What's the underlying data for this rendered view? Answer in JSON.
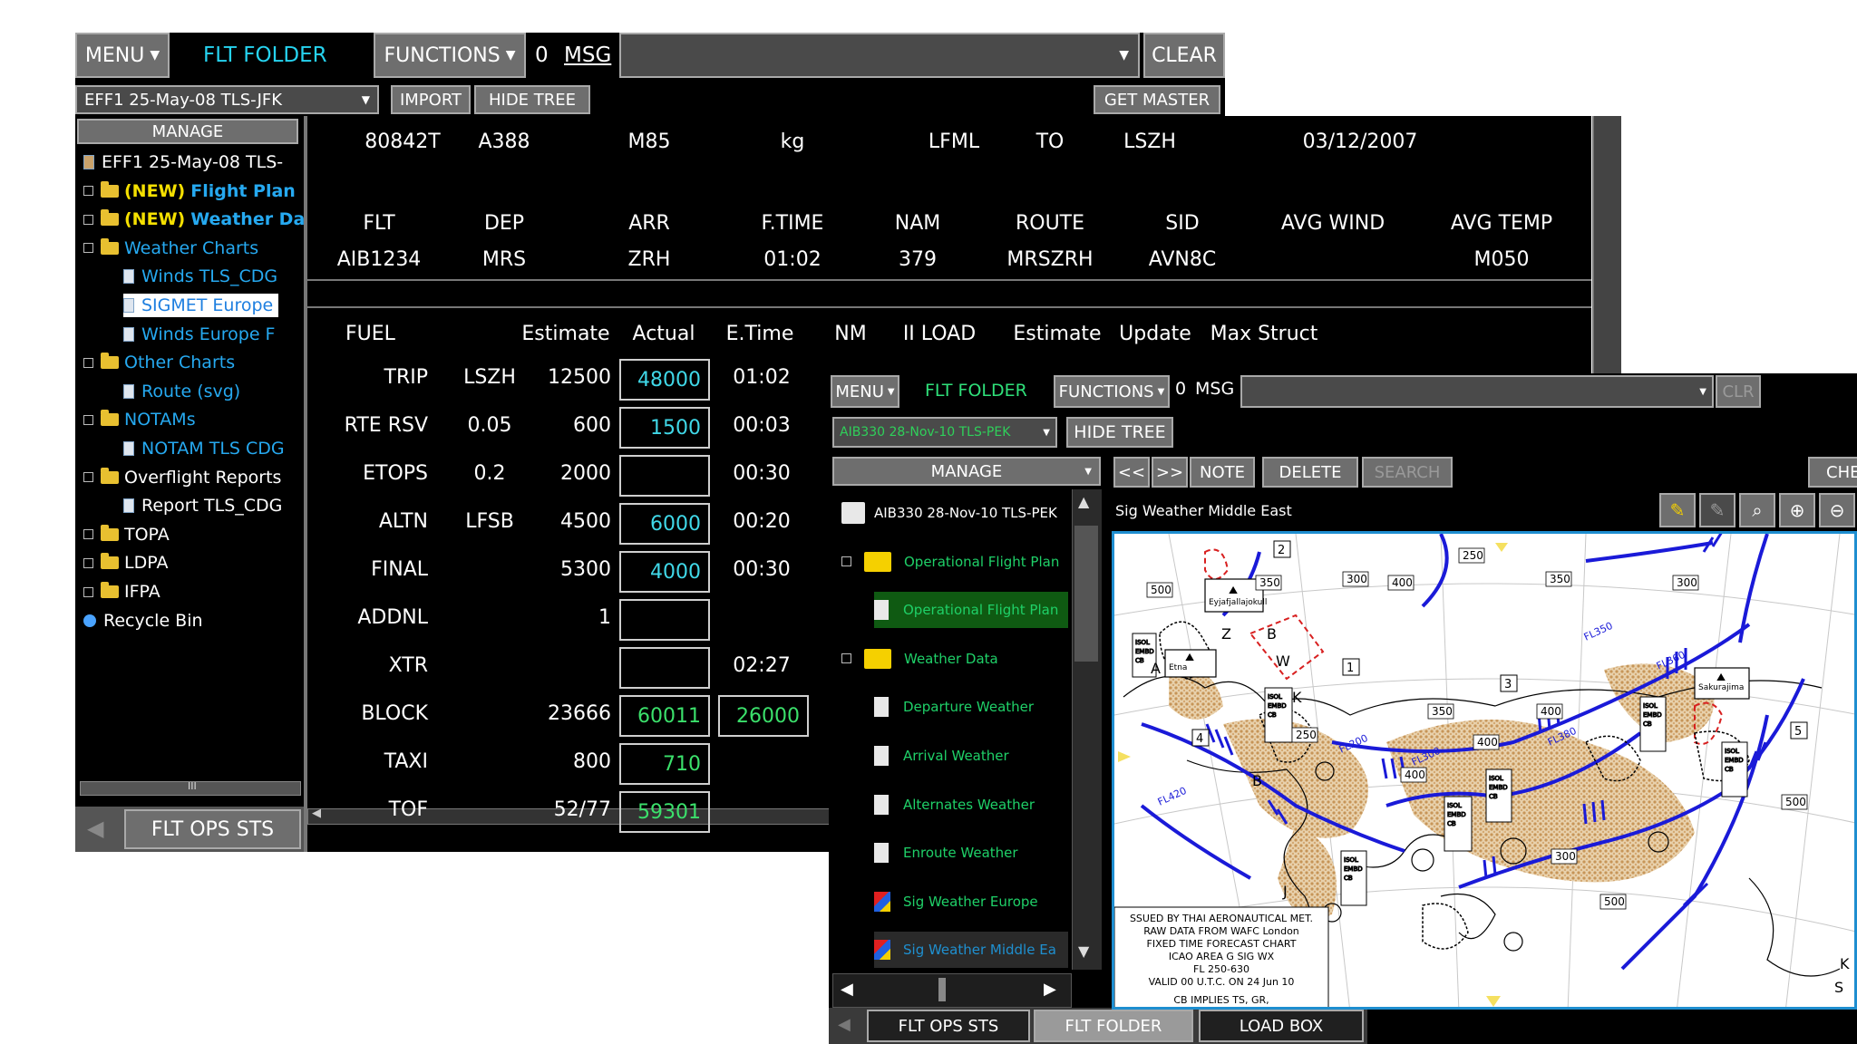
{
  "back_window": {
    "menu": "MENU",
    "app_title": "FLT FOLDER",
    "functions": "FUNCTIONS",
    "msg_count": "0",
    "msg_label": "MSG",
    "clear": "CLEAR",
    "flight_select": "EFF1 25-May-08 TLS-JFK",
    "import": "IMPORT",
    "hide_tree": "HIDE TREE",
    "get_master": "GET MASTER",
    "manage": "MANAGE",
    "tree": [
      {
        "label": "EFF1 25-May-08 TLS-",
        "kind": "root"
      },
      {
        "label": "(NEW) Flight Plan",
        "new_prefix": "(NEW)",
        "rest": "Flight Plan",
        "kind": "new"
      },
      {
        "label": "(NEW) Weather Da",
        "new_prefix": "(NEW)",
        "rest": "Weather Da",
        "kind": "new"
      },
      {
        "label": "Weather Charts",
        "kind": "folder-c"
      },
      {
        "label": "Winds TLS_CDG",
        "kind": "doc-c"
      },
      {
        "label": "SIGMET Europe",
        "kind": "doc-sel"
      },
      {
        "label": "Winds Europe F",
        "kind": "doc-c"
      },
      {
        "label": "Other Charts",
        "kind": "folder-c"
      },
      {
        "label": "Route (svg)",
        "kind": "doc-c"
      },
      {
        "label": "NOTAMs",
        "kind": "folder-c"
      },
      {
        "label": "NOTAM TLS CDG",
        "kind": "doc-c"
      },
      {
        "label": "Overflight Reports",
        "kind": "folder"
      },
      {
        "label": "Report TLS_CDG",
        "kind": "doc"
      },
      {
        "label": "TOPA",
        "kind": "folder"
      },
      {
        "label": "LDPA",
        "kind": "folder"
      },
      {
        "label": "IFPA",
        "kind": "folder"
      },
      {
        "label": "Recycle Bin",
        "kind": "bin"
      }
    ],
    "scroll_mark": "III",
    "bottom_tab": "FLT OPS STS",
    "header_row": [
      "80842T",
      "A388",
      "M85",
      "kg",
      "LFML",
      "TO",
      "LSZH",
      "03/12/2007"
    ],
    "flight_headers": [
      "FLT",
      "DEP",
      "ARR",
      "F.TIME",
      "NAM",
      "ROUTE",
      "SID",
      "AVG WIND",
      "AVG TEMP"
    ],
    "flight_values": [
      "AIB1234",
      "MRS",
      "ZRH",
      "01:02",
      "379",
      "MRSZRH",
      "AVN8C",
      "",
      "M050"
    ],
    "fuel_headers": [
      "FUEL",
      "Estimate",
      "Actual",
      "E.Time",
      "NM",
      "II LOAD",
      "Estimate",
      "Update",
      "Max Struct"
    ],
    "fuel_rows": [
      {
        "name": "TRIP",
        "ref": "LSZH",
        "estimate": "12500",
        "actual": "48000",
        "etime": "01:02"
      },
      {
        "name": "RTE RSV",
        "ref": "0.05",
        "estimate": "600",
        "actual": "1500",
        "etime": "00:03"
      },
      {
        "name": "ETOPS",
        "ref": "0.2",
        "estimate": "2000",
        "actual": "",
        "etime": "00:30"
      },
      {
        "name": "ALTN",
        "ref": "LFSB",
        "estimate": "4500",
        "actual": "6000",
        "etime": "00:20"
      },
      {
        "name": "FINAL",
        "ref": "",
        "estimate": "5300",
        "actual": "4000",
        "etime": "00:30"
      },
      {
        "name": "ADDNL",
        "ref": "",
        "estimate": "1",
        "actual": "",
        "etime": ""
      },
      {
        "name": "XTR",
        "ref": "",
        "estimate": "",
        "actual": "",
        "etime": "02:27"
      },
      {
        "name": "BLOCK",
        "ref": "",
        "estimate": "23666",
        "actual": "60011",
        "etime": "26000"
      },
      {
        "name": "TAXI",
        "ref": "",
        "estimate": "800",
        "actual": "710",
        "etime": ""
      },
      {
        "name": "TOF",
        "ref": "",
        "estimate": "52/77",
        "actual": "59301",
        "etime": ""
      }
    ]
  },
  "front_window": {
    "menu": "MENU",
    "app_title": "FLT FOLDER",
    "functions": "FUNCTIONS",
    "msg_count": "0",
    "msg_label": "MSG",
    "clear": "CLR",
    "flight_select": "AIB330 28-Nov-10 TLS-PEK",
    "hide_tree": "HIDE TREE",
    "manage": "MANAGE",
    "nav_prev": "<<",
    "nav_next": ">>",
    "note": "NOTE",
    "delete": "DELETE",
    "search": "SEARCH",
    "che": "CHE",
    "chart_title": "Sig Weather Middle East",
    "tree": [
      {
        "label": "AIB330 28-Nov-10 TLS-PEK",
        "kind": "root"
      },
      {
        "label": "Operational Flight Plan",
        "kind": "folder"
      },
      {
        "label": "Operational Flight Plan",
        "kind": "doc-sel"
      },
      {
        "label": "Weather Data",
        "kind": "folder"
      },
      {
        "label": "Departure Weather",
        "kind": "doc"
      },
      {
        "label": "Arrival Weather",
        "kind": "doc"
      },
      {
        "label": "Alternates Weather",
        "kind": "doc"
      },
      {
        "label": "Enroute Weather",
        "kind": "doc"
      },
      {
        "label": "Sig Weather Europe",
        "kind": "img"
      },
      {
        "label": "Sig Weather Middle Ea",
        "kind": "img-sel"
      }
    ],
    "tabs": [
      "FLT OPS STS",
      "FLT FOLDER",
      "LOAD BOX"
    ],
    "map": {
      "legend_lines": [
        "SSUED BY THAI AERONAUTICAL MET.",
        "RAW DATA FROM WAFC London",
        "FIXED TIME FORECAST CHART",
        "ICAO AREA G SIG WX",
        "FL 250-630",
        "VALID 00 U.T.C. ON 24 Jun 10"
      ],
      "footer": "CB IMPLIES TS, GR,",
      "volcano_labels": [
        "Eyjafjallajokull",
        "Etna",
        "Sakurajima"
      ],
      "numbers": [
        "250",
        "350",
        "300",
        "400",
        "500",
        "350",
        "300",
        "400",
        "250",
        "350",
        "400",
        "500",
        "500",
        "300",
        "400"
      ],
      "boxes": [
        "2",
        "1",
        "3",
        "4",
        "5"
      ],
      "letters": [
        "Z",
        "B",
        "W",
        "K",
        "A",
        "B",
        "J",
        "B",
        "S",
        "K"
      ],
      "fl_labels": [
        "FL200",
        "FL300",
        "FL380",
        "FL350",
        "FL360",
        "FL420"
      ],
      "cb_labels": [
        "ISOL EMBD CB",
        "ISOL EMBD CB",
        "ISOL EMBD CB",
        "ISOL EMBD CB",
        "ISOL EMBD CB",
        "ISOL EMBD CB",
        "ISOL EMBD CB"
      ]
    }
  }
}
